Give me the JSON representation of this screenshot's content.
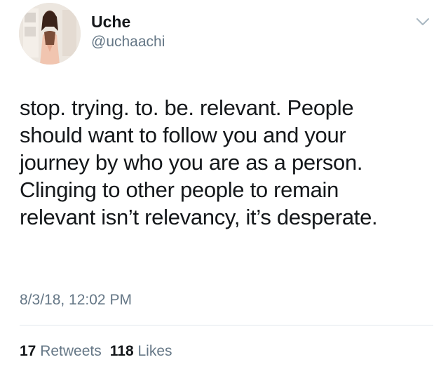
{
  "tweet": {
    "display_name": "Uche",
    "handle": "@uchaachi",
    "text_lines": [
      "stop. trying. to. be. relevant. People",
      "should want to follow you and your",
      "journey by who you are as a person.",
      "Clinging to other people to remain",
      "relevant isn’t relevancy, it’s desperate."
    ],
    "timestamp": "8/3/18, 12:02 PM",
    "stats": {
      "retweets_count": "17",
      "retweets_label": "Retweets",
      "likes_count": "118",
      "likes_label": "Likes"
    }
  },
  "icons": {
    "menu": "chevron-down-icon",
    "avatar": "profile-photo"
  },
  "colors": {
    "text_primary": "#14171a",
    "text_secondary": "#657786",
    "divider": "#e1e8ed",
    "background": "#ffffff"
  }
}
